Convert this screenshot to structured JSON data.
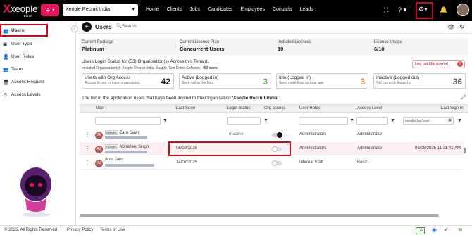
{
  "app": {
    "logo_text": "xeople",
    "logo_sub": "recruit",
    "org_selector": "Xeople Recruit India",
    "nav": [
      "Home",
      "Clients",
      "Jobs",
      "Candidates",
      "Employees",
      "Contacts",
      "Leads"
    ]
  },
  "sidebar": {
    "items": [
      {
        "label": "Users",
        "icon": "users-icon"
      },
      {
        "label": "User Type",
        "icon": "user-type-icon"
      },
      {
        "label": "User Roles",
        "icon": "user-roles-icon"
      },
      {
        "label": "Team",
        "icon": "team-icon"
      },
      {
        "label": "Access Request",
        "icon": "access-request-icon"
      },
      {
        "label": "Access Levels",
        "icon": "access-levels-icon"
      }
    ]
  },
  "page": {
    "title": "Users",
    "search_placeholder": "Search"
  },
  "summary": {
    "package_label": "Current Package",
    "package_value": "Platinum",
    "plan_label": "Current Licence Plan",
    "plan_value": "Concurrent Users",
    "included_label": "Included Licences",
    "included_value": "10",
    "usage_label": "Licence Usage",
    "usage_value": "6/10"
  },
  "status": {
    "title": "Users Login Status for (53) Organisation(s) Across this Tenant.",
    "sub_prefix": "Included Organisation(s): Xeople Recruit India, Xeople, Test Entire Software,",
    "sub_more": "+50 more",
    "logout_label": "Log out Idle user(s)",
    "cards": [
      {
        "title": "Users with Org Access",
        "sub": "Access to one or more organisation",
        "count": "42",
        "color": "#222"
      },
      {
        "title": "Active (Logged in)",
        "sub": "Seen within the hour",
        "count": "3",
        "color": "#6aa84f"
      },
      {
        "title": "Idle (Logged in)",
        "sub": "Seen more than an hour ago",
        "count": "3",
        "color": "#e69138"
      },
      {
        "title": "Inactive (Logged out)",
        "sub": "Not currently logged in",
        "count": "36",
        "color": "#666"
      }
    ]
  },
  "table": {
    "intro_prefix": "The list of the application users that have been invited to the Organisation ",
    "intro_org": "'Xeople Recruit India'",
    "columns": [
      "User",
      "Last Seen",
      "Login Status",
      "Org access",
      "User Roles",
      "Access Level",
      "Last Sign In"
    ],
    "date_placeholder": "month/day/year",
    "rows": [
      {
        "name": "Zara Davis",
        "badge": "ADMIN",
        "last_seen": "",
        "login_status": "Inactive",
        "org_access": true,
        "role": "Administrators",
        "access": "Administrator",
        "last_sign_in": ""
      },
      {
        "name": "Abhishek Singh",
        "badge": "ADMIN",
        "last_seen": "06/08/2025",
        "login_status": "",
        "org_access": false,
        "role": "Administrators",
        "access": "Administrator",
        "last_sign_in": "06/08/2025 11:31:41 AM"
      },
      {
        "name": "Anuj Jain",
        "badge": "",
        "last_seen": "14/07/2025",
        "login_status": "",
        "org_access": false,
        "role": "Internal Staff",
        "access": "Basic",
        "last_sign_in": ""
      }
    ]
  },
  "footer": {
    "copyright": "© 2025. All Rights Reserved",
    "privacy": "Privacy Policy",
    "terms": "Terms of Use",
    "qa_badge": "QA"
  }
}
